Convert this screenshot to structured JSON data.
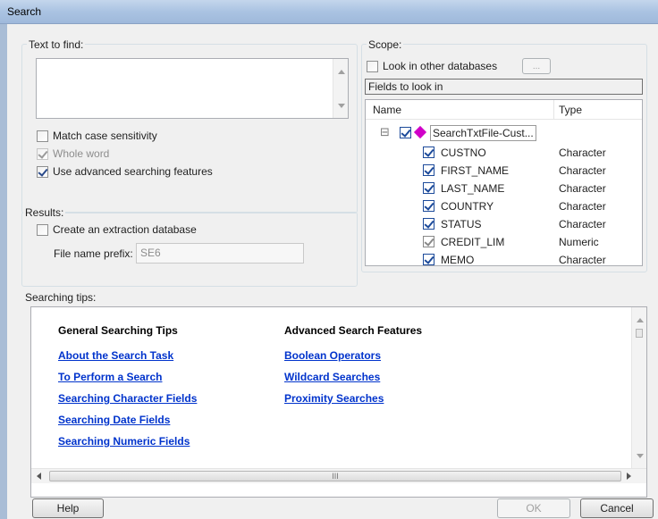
{
  "window": {
    "title": "Search"
  },
  "text_to_find": {
    "label": "Text to find:",
    "value": "",
    "options": [
      {
        "label": "Match case sensitivity",
        "checked": false,
        "enabled": true
      },
      {
        "label": "Whole word",
        "checked": true,
        "enabled": false
      },
      {
        "label": "Use advanced searching features",
        "checked": true,
        "enabled": true
      }
    ]
  },
  "results": {
    "label": "Results:",
    "create_extraction": {
      "label": "Create an extraction database",
      "checked": false
    },
    "file_name_prefix": {
      "label": "File name prefix:",
      "value": "SE6"
    }
  },
  "scope": {
    "label": "Scope:",
    "look_in_other": {
      "label": "Look in other databases",
      "checked": false
    },
    "browse_button": "...",
    "fields_label": "Fields to look in",
    "columns": [
      "Name",
      "Type"
    ],
    "root": {
      "name": "SearchTxtFile-Cust...",
      "expander": "⊟"
    },
    "fields": [
      {
        "name": "CUSTNO",
        "type": "Character",
        "checked": true,
        "grey": false
      },
      {
        "name": "FIRST_NAME",
        "type": "Character",
        "checked": true,
        "grey": false
      },
      {
        "name": "LAST_NAME",
        "type": "Character",
        "checked": true,
        "grey": false
      },
      {
        "name": "COUNTRY",
        "type": "Character",
        "checked": true,
        "grey": false
      },
      {
        "name": "STATUS",
        "type": "Character",
        "checked": true,
        "grey": false
      },
      {
        "name": "CREDIT_LIM",
        "type": "Numeric",
        "checked": true,
        "grey": true
      },
      {
        "name": "MEMO",
        "type": "Character",
        "checked": true,
        "grey": false
      }
    ]
  },
  "tips": {
    "label": "Searching tips:",
    "general_heading": "General Searching Tips",
    "general_links": [
      "About the Search Task",
      "To Perform a Search",
      "Searching Character Fields",
      "Searching Date Fields",
      "Searching Numeric Fields"
    ],
    "advanced_heading": "Advanced Search Features",
    "advanced_links": [
      "Boolean Operators",
      "Wildcard Searches",
      "Proximity Searches"
    ],
    "hscroll_grip": "III"
  },
  "buttons": {
    "help": "Help",
    "ok": "OK",
    "cancel": "Cancel"
  }
}
